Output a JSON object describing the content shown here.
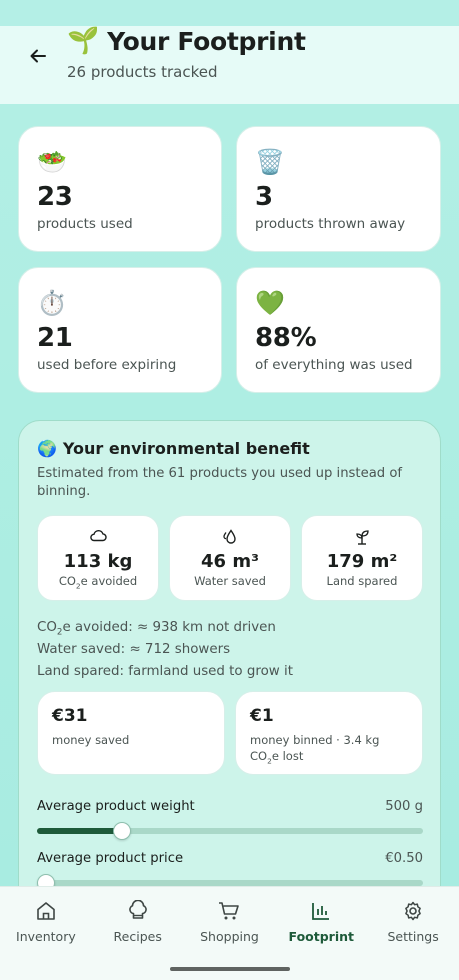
{
  "header": {
    "title_emoji": "🌱",
    "title": "Your Footprint",
    "subtitle": "26 products tracked"
  },
  "stats": [
    {
      "emoji": "🥗",
      "value": "23",
      "label": "products used"
    },
    {
      "emoji": "🗑️",
      "value": "3",
      "label": "products thrown away"
    },
    {
      "emoji": "⏱️",
      "value": "21",
      "label": "used before expiring"
    },
    {
      "emoji": "💚",
      "value": "88%",
      "label": "of everything was used"
    }
  ],
  "environment": {
    "emoji": "🌍",
    "title": "Your environmental benefit",
    "description": "Estimated from the 61 products you used up instead of binning.",
    "metrics": [
      {
        "icon": "cloud-icon",
        "value": "113 kg",
        "label_main": "CO",
        "label_sub": "2",
        "label_rest": "e avoided"
      },
      {
        "icon": "water-drop-icon",
        "value": "46 m³",
        "label": "Water saved"
      },
      {
        "icon": "sprout-icon",
        "value": "179 m²",
        "label": "Land spared"
      }
    ],
    "equivalents": {
      "co2_prefix": "CO",
      "co2_sub": "2",
      "co2_rest": "e avoided: ≈ 938 km not driven",
      "water": "Water saved: ≈ 712 showers",
      "land": "Land spared: farmland used to grow it"
    },
    "money_saved": {
      "value": "€31",
      "label": "money saved"
    },
    "money_binned": {
      "value": "€1",
      "label_prefix": "money binned · 3.4 kg CO",
      "label_sub": "2",
      "label_rest": "e lost"
    },
    "sliders": [
      {
        "label": "Average product weight",
        "value": "500 g",
        "fraction": 0.22
      },
      {
        "label": "Average product price",
        "value": "€0.50",
        "fraction": 0.0
      }
    ]
  },
  "nav": [
    {
      "icon": "home-icon",
      "label": "Inventory",
      "active": false
    },
    {
      "icon": "chef-hat-icon",
      "label": "Recipes",
      "active": false
    },
    {
      "icon": "cart-icon",
      "label": "Shopping",
      "active": false
    },
    {
      "icon": "bar-chart-icon",
      "label": "Footprint",
      "active": true
    },
    {
      "icon": "gear-icon",
      "label": "Settings",
      "active": false
    }
  ],
  "colors": {
    "accent": "#1e5a3a",
    "background": "#b4efe6"
  }
}
